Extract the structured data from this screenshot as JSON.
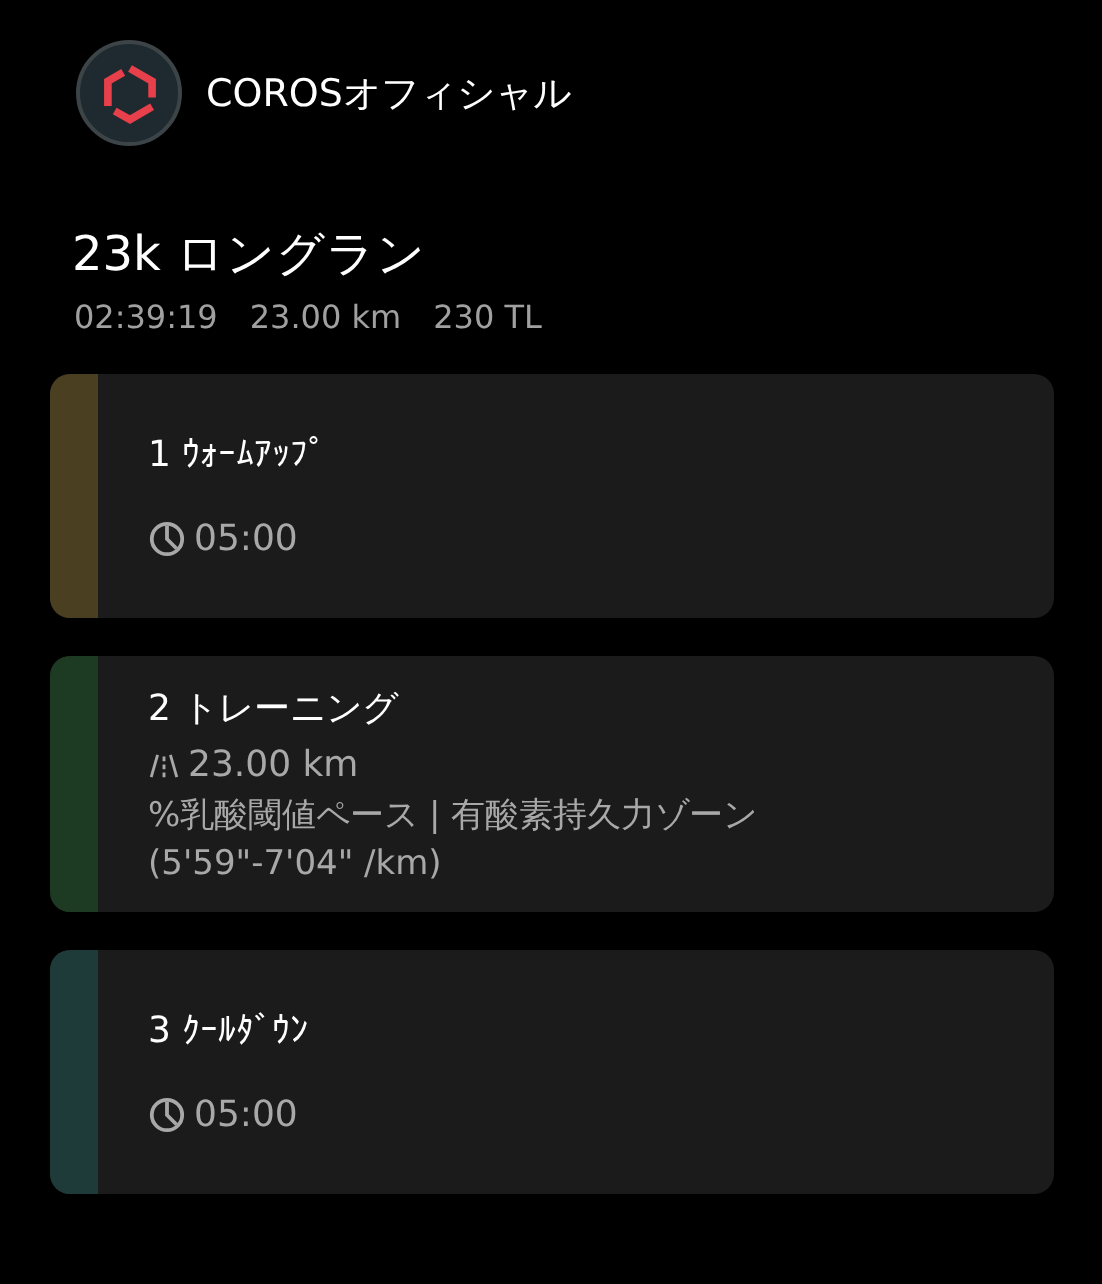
{
  "author": {
    "name": "COROSオフィシャル"
  },
  "workout": {
    "title": "23k ロングラン",
    "stats": [
      "02:39:19",
      "23.00 km",
      "230 TL"
    ]
  },
  "steps": [
    {
      "title": "1 ｳｫｰﾑｱｯﾌﾟ",
      "color": "#4a3f20",
      "kind": "time",
      "value": "05:00"
    },
    {
      "title": "2 トレーニング",
      "color": "#1d3a22",
      "kind": "distance",
      "value": "23.00 km",
      "notes": [
        "%乳酸閾値ペース | 有酸素持久力ゾーン",
        "(5'59\"-7'04\" /km)"
      ]
    },
    {
      "title": "3 ｸｰﾙﾀﾞｳﾝ",
      "color": "#1f3b39",
      "kind": "time",
      "value": "05:00"
    }
  ]
}
